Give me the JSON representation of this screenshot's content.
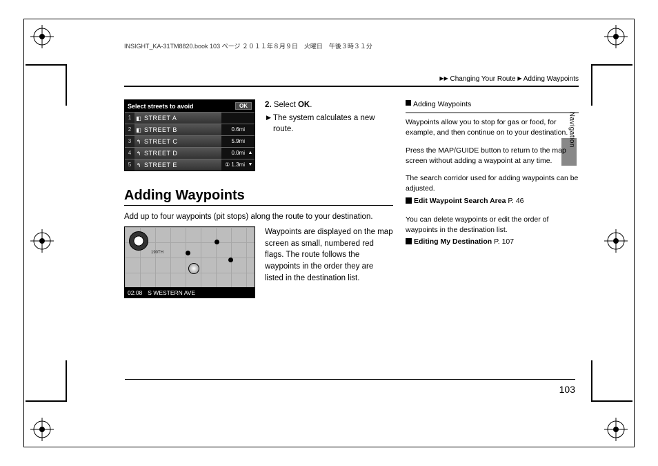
{
  "meta": {
    "header_line": "INSIGHT_KA-31TM8820.book  103 ページ  ２０１１年８月９日　火曜日　午後３時３１分"
  },
  "breadcrumb": {
    "tri": "▶▶",
    "part1": "Changing Your Route",
    "tri2": "▶",
    "part2": "Adding Waypoints"
  },
  "side": {
    "label": "Navigation",
    "page_number": "103"
  },
  "step2": {
    "num": "2.",
    "action_prefix": "Select ",
    "action_bold": "OK",
    "action_suffix": ".",
    "tri": "▶",
    "result": "The system calculates a new route."
  },
  "screen_avoid": {
    "title": "Select streets to avoid",
    "ok": "OK",
    "rows": [
      {
        "n": "1",
        "ic": "◧",
        "name": "STREET A",
        "dist": "",
        "arr": ""
      },
      {
        "n": "2",
        "ic": "◧",
        "name": "STREET B",
        "dist": "0.6mi",
        "arr": ""
      },
      {
        "n": "3",
        "ic": "↰",
        "name": "STREET C",
        "dist": "5.9mi",
        "arr": ""
      },
      {
        "n": "4",
        "ic": "↰",
        "name": "STREET D",
        "dist": "0.0mi",
        "arr": "▲"
      },
      {
        "n": "5",
        "ic": "↰",
        "name": "STREET E",
        "dist": "1.3mi",
        "arr": "▼"
      }
    ],
    "footer_indicator": "①"
  },
  "section": {
    "title": "Adding Waypoints",
    "intro": "Add up to four waypoints (pit stops) along the route to your destination.",
    "map_desc": "Waypoints are displayed on the map screen as small, numbered red flags. The route follows the waypoints in the order they are listed in the destination list."
  },
  "map": {
    "clock": "02:08",
    "street": "S WESTERN AVE",
    "labels": {
      "a": "190TH"
    }
  },
  "margin": {
    "head_glyph": "≫",
    "head": "Adding Waypoints",
    "p1": "Waypoints allow you to stop for gas or food, for example, and then continue on to your destination.",
    "p2": "Press the MAP/GUIDE button to return to the map screen without adding a waypoint at any time.",
    "p3": "The search corridor used for adding waypoints can be adjusted.",
    "ref1_label": "Edit Waypoint Search Area",
    "ref1_page": "P. 46",
    "p4": "You can delete waypoints or edit the order of waypoints in the destination list.",
    "ref2_label": "Editing My Destination",
    "ref2_page": "P. 107"
  }
}
